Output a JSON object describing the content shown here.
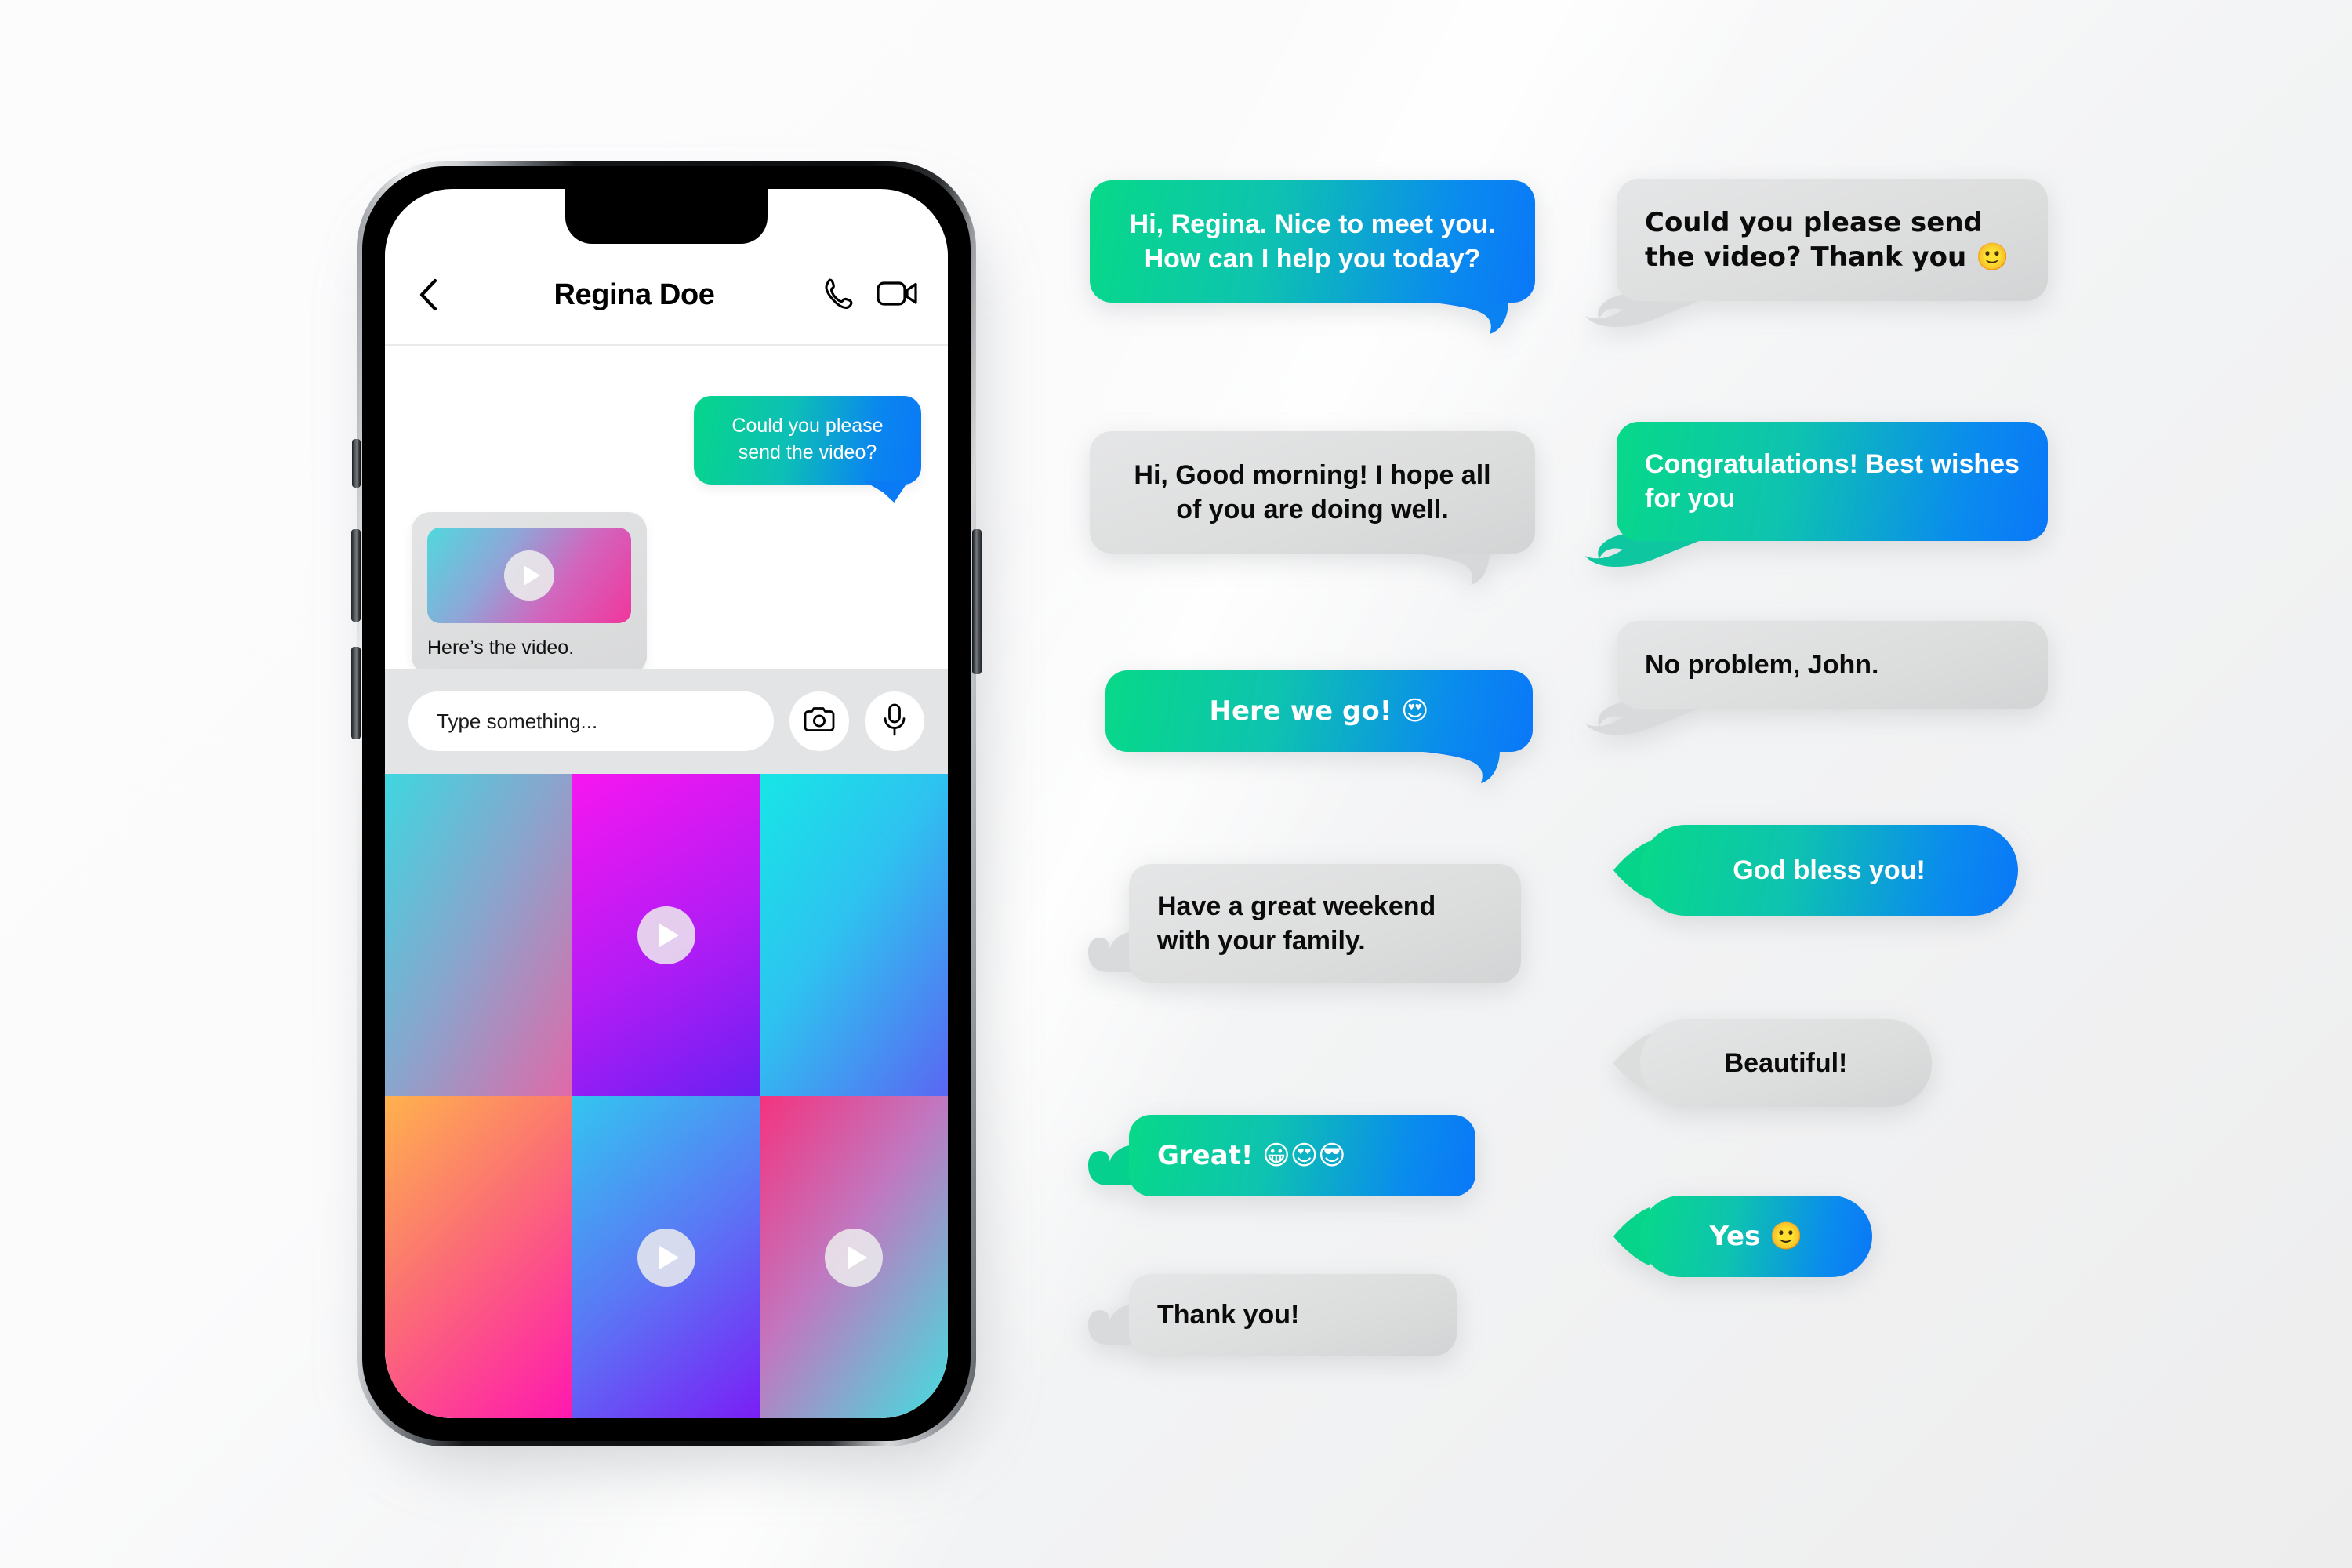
{
  "phone": {
    "header": {
      "back_icon": "chevron-left-icon",
      "contact_name": "Regina Doe",
      "call_icon": "phone-icon",
      "video_icon": "video-camera-icon"
    },
    "messages": [
      {
        "id": "m1",
        "side": "outgoing",
        "text": "Could you please send the video?"
      },
      {
        "id": "m2",
        "side": "incoming",
        "has_video": true,
        "video_play_icon": "play-icon",
        "text": "Here’s the video."
      }
    ],
    "input_bar": {
      "placeholder": "Type something...",
      "camera_icon": "camera-icon",
      "mic_icon": "microphone-icon"
    },
    "media_grid": {
      "cells": [
        {
          "id": "c1",
          "has_play": false,
          "gradient_class": "g1"
        },
        {
          "id": "c2",
          "has_play": true,
          "gradient_class": "g2"
        },
        {
          "id": "c3",
          "has_play": false,
          "gradient_class": "g3"
        },
        {
          "id": "c4",
          "has_play": false,
          "gradient_class": "g4"
        },
        {
          "id": "c5",
          "has_play": true,
          "gradient_class": "g5"
        },
        {
          "id": "c6",
          "has_play": true,
          "gradient_class": "g6"
        }
      ],
      "play_icon": "play-icon"
    }
  },
  "bubbles": {
    "column_left": [
      {
        "id": "b1",
        "style": "outgoing",
        "text": "Hi, Regina. Nice to meet you. How can I help you today?"
      },
      {
        "id": "b2",
        "style": "incoming",
        "text": "Hi, Good morning! I hope all of you are doing well."
      },
      {
        "id": "b3",
        "style": "outgoing",
        "text": "Here we go! 😍"
      },
      {
        "id": "b4",
        "style": "incoming",
        "text": "Have a great weekend with your family."
      },
      {
        "id": "b5",
        "style": "outgoing",
        "text": "Great! 😀😍😎"
      },
      {
        "id": "b6",
        "style": "incoming",
        "text": "Thank you!"
      }
    ],
    "column_right": [
      {
        "id": "b7",
        "style": "incoming",
        "text": "Could you please send the video? Thank you 🙂"
      },
      {
        "id": "b8",
        "style": "outgoing",
        "text": "Congratulations! Best wishes for you"
      },
      {
        "id": "b9",
        "style": "incoming",
        "text": "No problem, John."
      },
      {
        "id": "b10",
        "style": "outgoing",
        "text": "God bless you!"
      },
      {
        "id": "b11",
        "style": "incoming",
        "text": "Beautiful!"
      },
      {
        "id": "b12",
        "style": "outgoing",
        "text": "Yes 🙂"
      }
    ]
  },
  "colors": {
    "gradient_start": "#07d988",
    "gradient_mid": "#0ec3b0",
    "gradient_end": "#0a77f8",
    "incoming_bubble": "#dcdddd",
    "page_background": "#f4f5f6",
    "text_on_gradient": "#ffffff",
    "text_on_grey": "#0b0b0b"
  }
}
